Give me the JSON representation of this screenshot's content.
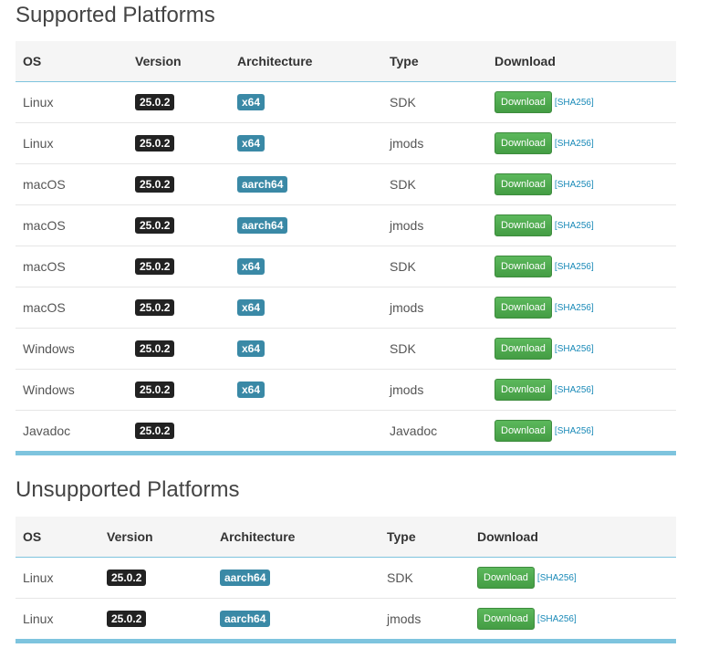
{
  "supported": {
    "title": "Supported Platforms",
    "headers": [
      "OS",
      "Version",
      "Architecture",
      "Type",
      "Download"
    ],
    "rows": [
      {
        "os": "Linux",
        "version": "25.0.2",
        "arch": "x64",
        "type": "SDK",
        "download": "Download",
        "sha": "[SHA256]"
      },
      {
        "os": "Linux",
        "version": "25.0.2",
        "arch": "x64",
        "type": "jmods",
        "download": "Download",
        "sha": "[SHA256]"
      },
      {
        "os": "macOS",
        "version": "25.0.2",
        "arch": "aarch64",
        "type": "SDK",
        "download": "Download",
        "sha": "[SHA256]"
      },
      {
        "os": "macOS",
        "version": "25.0.2",
        "arch": "aarch64",
        "type": "jmods",
        "download": "Download",
        "sha": "[SHA256]"
      },
      {
        "os": "macOS",
        "version": "25.0.2",
        "arch": "x64",
        "type": "SDK",
        "download": "Download",
        "sha": "[SHA256]"
      },
      {
        "os": "macOS",
        "version": "25.0.2",
        "arch": "x64",
        "type": "jmods",
        "download": "Download",
        "sha": "[SHA256]"
      },
      {
        "os": "Windows",
        "version": "25.0.2",
        "arch": "x64",
        "type": "SDK",
        "download": "Download",
        "sha": "[SHA256]"
      },
      {
        "os": "Windows",
        "version": "25.0.2",
        "arch": "x64",
        "type": "jmods",
        "download": "Download",
        "sha": "[SHA256]"
      },
      {
        "os": "Javadoc",
        "version": "25.0.2",
        "arch": "",
        "type": "Javadoc",
        "download": "Download",
        "sha": "[SHA256]"
      }
    ]
  },
  "unsupported": {
    "title": "Unsupported Platforms",
    "headers": [
      "OS",
      "Version",
      "Architecture",
      "Type",
      "Download"
    ],
    "rows": [
      {
        "os": "Linux",
        "version": "25.0.2",
        "arch": "aarch64",
        "type": "SDK",
        "download": "Download",
        "sha": "[SHA256]"
      },
      {
        "os": "Linux",
        "version": "25.0.2",
        "arch": "aarch64",
        "type": "jmods",
        "download": "Download",
        "sha": "[SHA256]"
      }
    ]
  },
  "colors": {
    "version_badge": "#222222",
    "arch_badge": "#3a89a6",
    "download_button": "#5cb85c",
    "accent_border": "#7ec4de",
    "sha_link": "#1a8ab8"
  }
}
